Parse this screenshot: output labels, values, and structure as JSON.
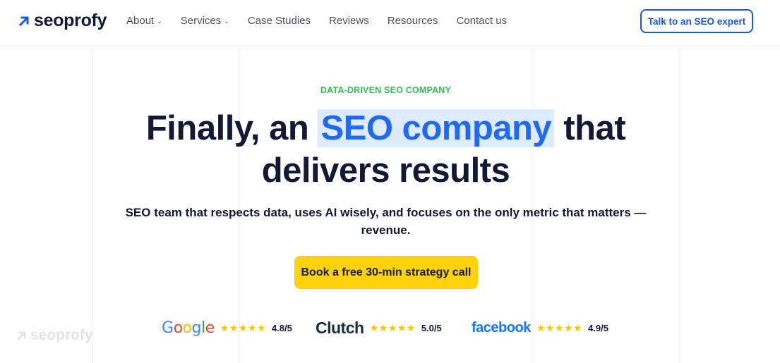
{
  "header": {
    "logo_text": "seoprofy",
    "nav": [
      {
        "label": "About",
        "has_dropdown": true
      },
      {
        "label": "Services",
        "has_dropdown": true
      },
      {
        "label": "Case Studies",
        "has_dropdown": false
      },
      {
        "label": "Reviews",
        "has_dropdown": false
      },
      {
        "label": "Resources",
        "has_dropdown": false
      },
      {
        "label": "Contact us",
        "has_dropdown": false
      }
    ],
    "cta_label": "Talk to an SEO expert"
  },
  "hero": {
    "eyebrow": "DATA-DRIVEN SEO COMPANY",
    "title_before": "Finally, an",
    "title_highlight": "SEO company",
    "title_after": "that",
    "title_line2": "delivers results",
    "subtitle": "SEO team that respects data, uses AI wisely, and focuses on the only metric that matters — revenue.",
    "cta_label": "Book a free 30-min strategy call"
  },
  "ratings": [
    {
      "brand": "Google",
      "stars": "★★★★★",
      "score": "4.8/5"
    },
    {
      "brand": "Clutch",
      "stars": "★★★★★",
      "score": "5.0/5"
    },
    {
      "brand": "facebook",
      "stars": "★★★★★",
      "score": "4.9/5"
    }
  ],
  "watermark_text": "seoprofy",
  "colors": {
    "brand_blue": "#1d58d6",
    "highlight_text": "#1f6bf0",
    "highlight_bg": "#ddeaff",
    "eyebrow_green": "#2fbf52",
    "cta_yellow": "#ffd20a",
    "star_gold": "#ffc400",
    "text_dark": "#121a33"
  }
}
